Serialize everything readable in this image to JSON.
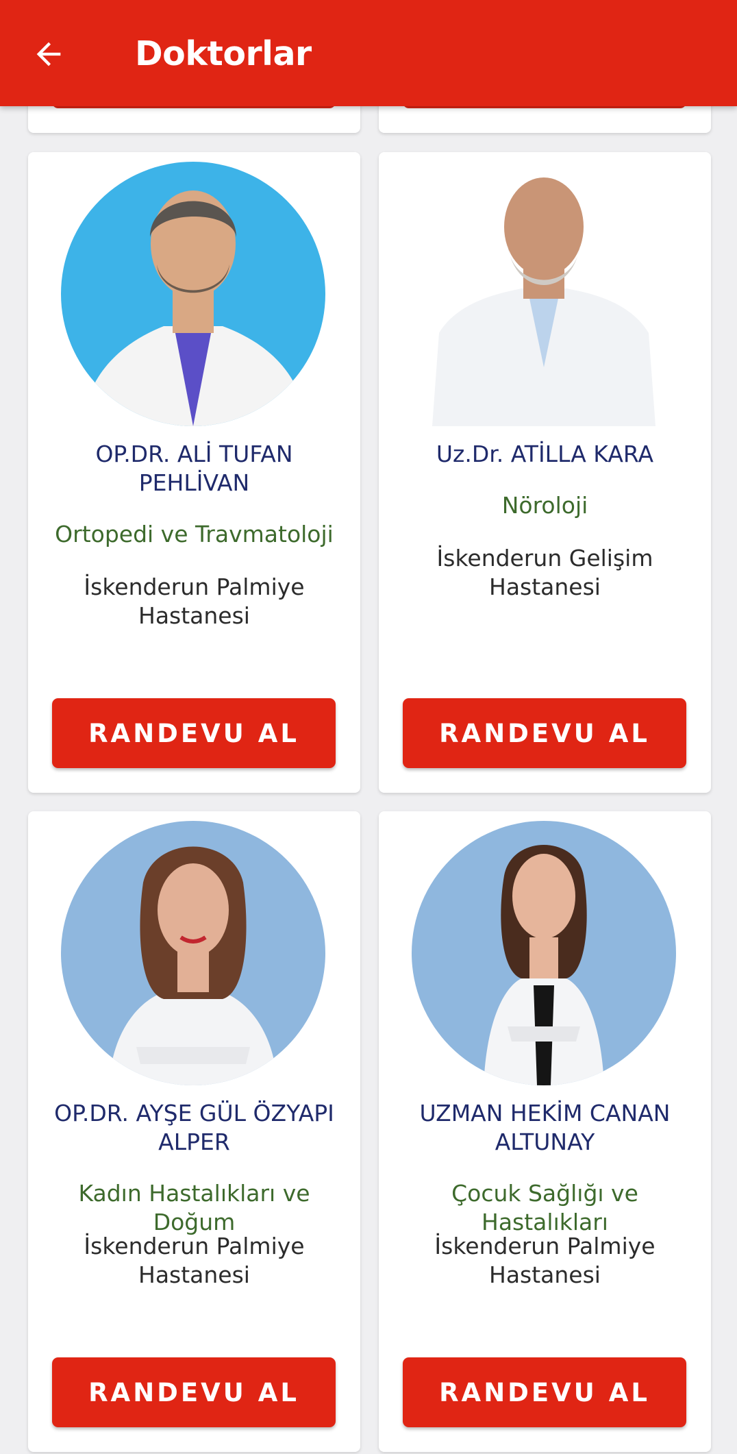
{
  "app_bar": {
    "title": "Doktorlar",
    "color": "#e02514"
  },
  "doctors": [
    {
      "name": "OP.DR. ALİ TUFAN PEHLİVAN",
      "department": "Ortopedi ve Travmatoloji",
      "hospital": "İskenderun Palmiye Hastanesi",
      "button": "RANDEVU AL",
      "photo_bg": "#3db3e8"
    },
    {
      "name": "Uz.Dr. ATİLLA KARA",
      "department": "Nöroloji",
      "hospital": "İskenderun Gelişim Hastanesi",
      "button": "RANDEVU AL",
      "photo_bg": "#ffffff"
    },
    {
      "name": "OP.DR. AYŞE GÜL ÖZYAPI ALPER",
      "department": "Kadın Hastalıkları ve Doğum",
      "hospital": "İskenderun Palmiye Hastanesi",
      "button": "RANDEVU AL",
      "photo_bg": "#8fb7de"
    },
    {
      "name": "UZMAN HEKİM CANAN  ALTUNAY",
      "department": "Çocuk Sağlığı ve Hastalıkları",
      "hospital": "İskenderun Palmiye Hastanesi",
      "button": "RANDEVU AL",
      "photo_bg": "#8fb7de"
    }
  ],
  "colors": {
    "name": "#1f2a6b",
    "department": "#3d6a2c",
    "button": "#e02514"
  }
}
